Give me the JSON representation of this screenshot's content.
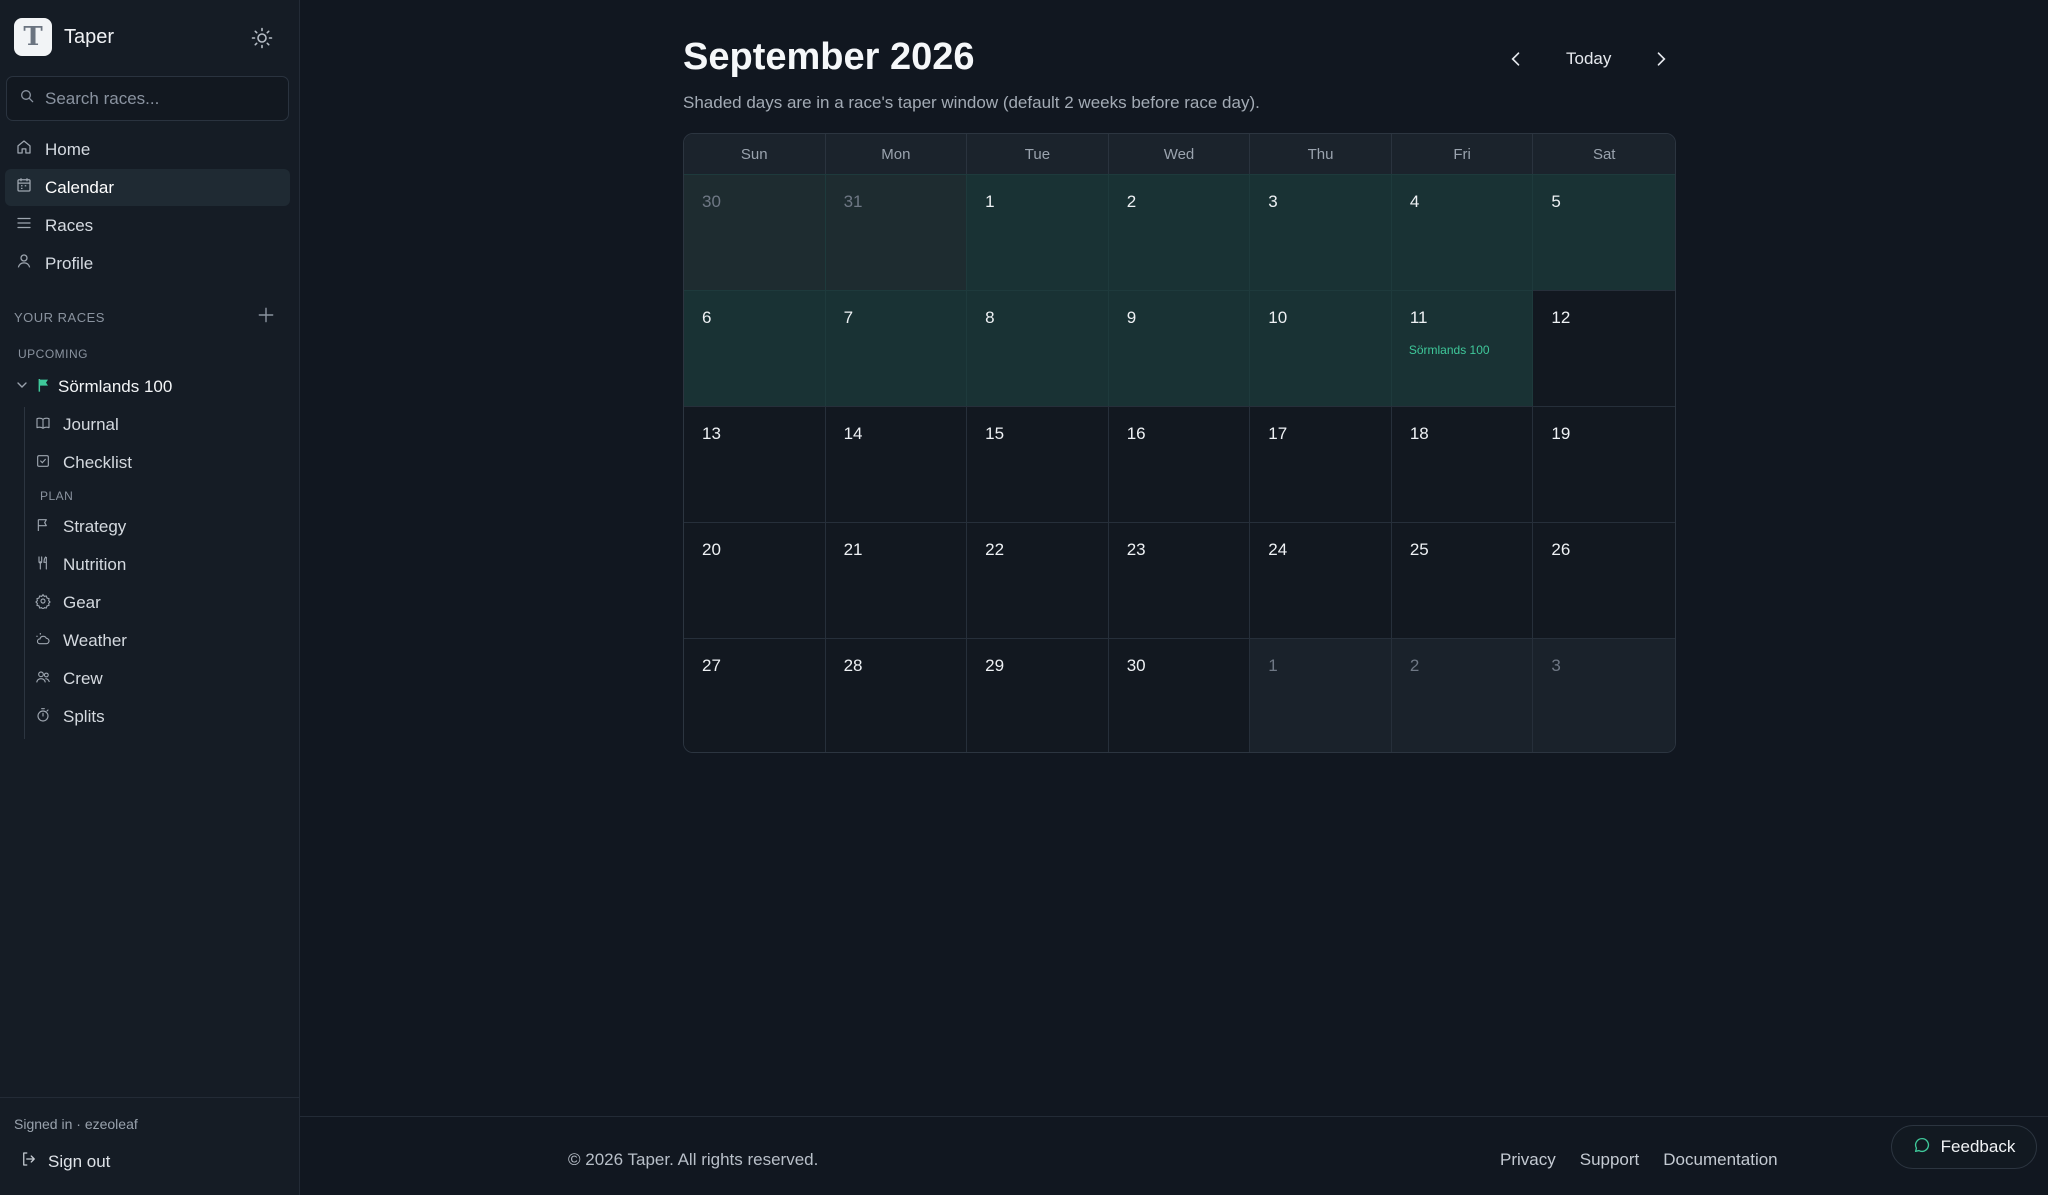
{
  "app": {
    "name": "Taper",
    "logo_letter": "T"
  },
  "search": {
    "placeholder": "Search races..."
  },
  "nav": [
    {
      "label": "Home",
      "icon": "home-icon"
    },
    {
      "label": "Calendar",
      "icon": "calendar-icon",
      "active": true
    },
    {
      "label": "Races",
      "icon": "list-icon"
    },
    {
      "label": "Profile",
      "icon": "user-icon"
    }
  ],
  "sidebar": {
    "your_races_label": "YOUR RACES",
    "upcoming_label": "UPCOMING",
    "race_name": "Sörmlands 100",
    "race_items": [
      {
        "label": "Journal",
        "icon": "book-icon"
      },
      {
        "label": "Checklist",
        "icon": "checkbox-icon"
      }
    ],
    "plan_label": "PLAN",
    "plan_items": [
      {
        "label": "Strategy",
        "icon": "flag-icon"
      },
      {
        "label": "Nutrition",
        "icon": "utensils-icon"
      },
      {
        "label": "Gear",
        "icon": "gear-icon"
      },
      {
        "label": "Weather",
        "icon": "cloud-sun-icon"
      },
      {
        "label": "Crew",
        "icon": "users-icon"
      },
      {
        "label": "Splits",
        "icon": "stopwatch-icon"
      }
    ],
    "signed_in": "Signed in · ezeoleaf",
    "sign_out": "Sign out"
  },
  "calendar": {
    "title": "September 2026",
    "subtitle": "Shaded days are in a race's taper window (default 2 weeks before race day).",
    "today_label": "Today",
    "weekdays": [
      "Sun",
      "Mon",
      "Tue",
      "Wed",
      "Thu",
      "Fri",
      "Sat"
    ],
    "days": [
      {
        "d": "30",
        "outside": true,
        "taper": true
      },
      {
        "d": "31",
        "outside": true,
        "taper": true
      },
      {
        "d": "1",
        "taper": true
      },
      {
        "d": "2",
        "taper": true
      },
      {
        "d": "3",
        "taper": true
      },
      {
        "d": "4",
        "taper": true
      },
      {
        "d": "5",
        "taper": true
      },
      {
        "d": "6",
        "taper": true
      },
      {
        "d": "7",
        "taper": true
      },
      {
        "d": "8",
        "taper": true
      },
      {
        "d": "9",
        "taper": true
      },
      {
        "d": "10",
        "taper": true
      },
      {
        "d": "11",
        "taper": true,
        "event": "Sörmlands 100"
      },
      {
        "d": "12"
      },
      {
        "d": "13"
      },
      {
        "d": "14"
      },
      {
        "d": "15"
      },
      {
        "d": "16"
      },
      {
        "d": "17"
      },
      {
        "d": "18"
      },
      {
        "d": "19"
      },
      {
        "d": "20"
      },
      {
        "d": "21"
      },
      {
        "d": "22"
      },
      {
        "d": "23"
      },
      {
        "d": "24"
      },
      {
        "d": "25"
      },
      {
        "d": "26"
      },
      {
        "d": "27"
      },
      {
        "d": "28"
      },
      {
        "d": "29"
      },
      {
        "d": "30"
      },
      {
        "d": "1",
        "outside": true
      },
      {
        "d": "2",
        "outside": true
      },
      {
        "d": "3",
        "outside": true
      }
    ]
  },
  "footer": {
    "copyright": "© 2026 Taper. All rights reserved.",
    "links": [
      "Privacy",
      "Support",
      "Documentation"
    ],
    "feedback": "Feedback"
  },
  "colors": {
    "accent": "#3fc89a",
    "taper_bg": "#193234",
    "background": "#111720"
  }
}
